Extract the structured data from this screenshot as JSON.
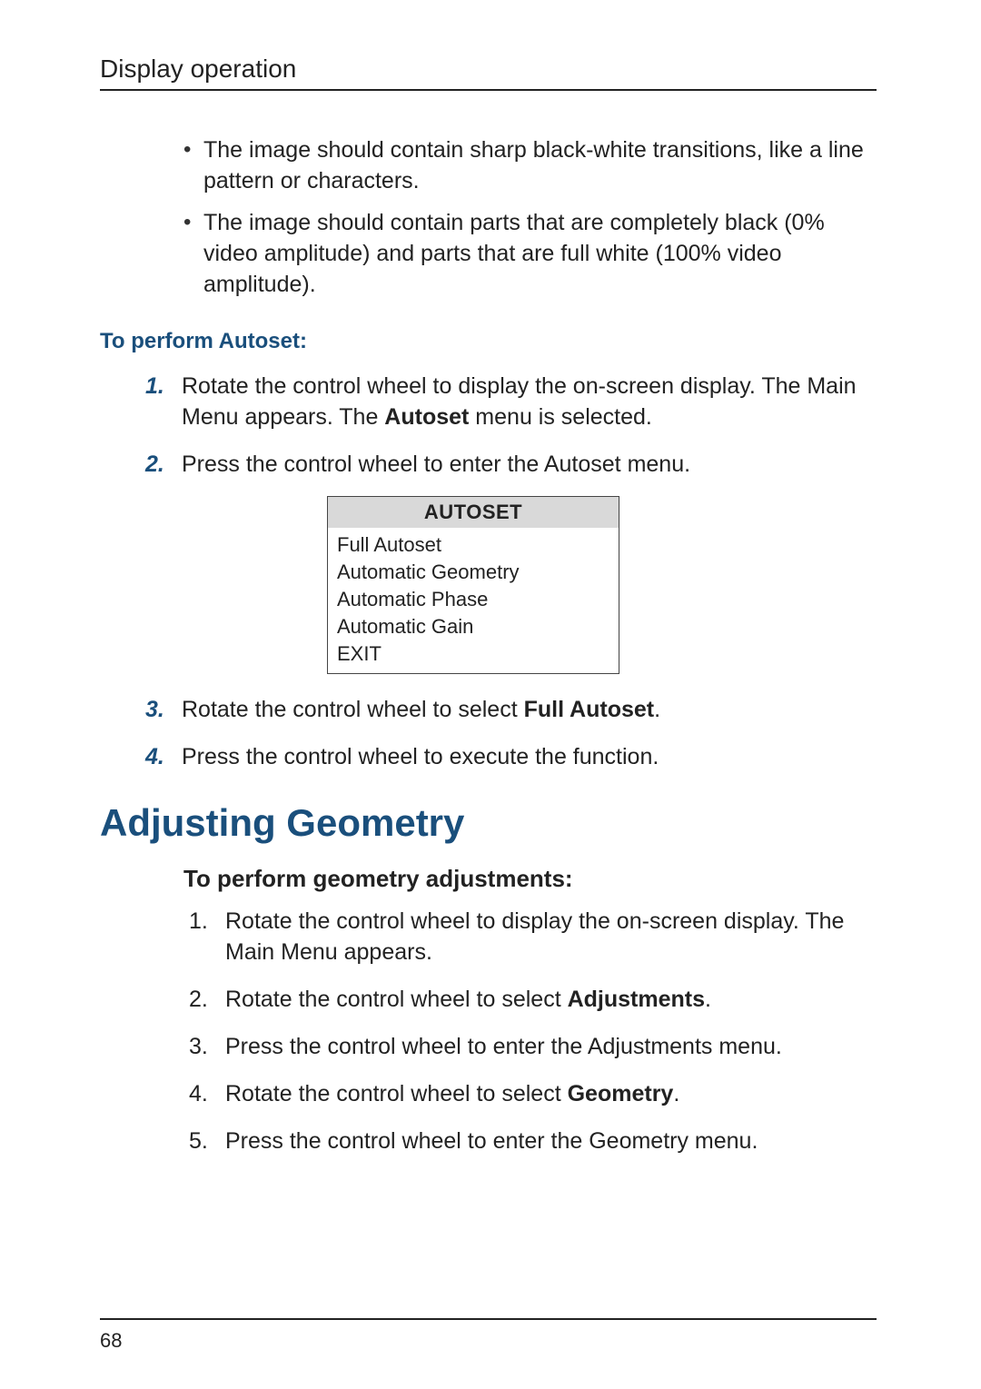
{
  "header": {
    "section": "Display operation"
  },
  "intro_bullets": [
    "The image should contain sharp black-white transitions, like a line pattern or characters.",
    "The image should contain parts that are completely black (0% video amplitude) and parts that are full white (100% video amplitude)."
  ],
  "autoset_heading": "To perform Autoset:",
  "autoset_steps": {
    "s1": {
      "num": "1.",
      "pre": "Rotate the control wheel to display the on-screen display. The Main Menu appears. The ",
      "bold": "Autoset",
      "post": " menu is selected."
    },
    "s2": {
      "num": "2.",
      "text": "Press the control wheel to enter the Autoset menu."
    },
    "s3": {
      "num": "3.",
      "pre": "Rotate the control wheel to select ",
      "bold": "Full Autoset",
      "post": "."
    },
    "s4": {
      "num": "4.",
      "text": "Press the control wheel to execute the function."
    }
  },
  "autoset_menu": {
    "title": "AUTOSET",
    "items": [
      "Full Autoset",
      "Automatic Geometry",
      "Automatic Phase",
      "Automatic Gain",
      "EXIT"
    ]
  },
  "h1": "Adjusting Geometry",
  "geometry_heading": "To perform geometry adjustments:",
  "geometry_steps": {
    "g1": {
      "num": "1.",
      "text": "Rotate the control wheel to display the on-screen display. The Main Menu appears."
    },
    "g2": {
      "num": "2.",
      "pre": "Rotate the control wheel to select ",
      "bold": "Adjustments",
      "post": "."
    },
    "g3": {
      "num": "3.",
      "text": "Press the control wheel to enter the Adjustments menu."
    },
    "g4": {
      "num": "4.",
      "pre": "Rotate the control wheel to select ",
      "bold": "Geometry",
      "post": "."
    },
    "g5": {
      "num": "5.",
      "text": "Press the control wheel to enter the Geometry menu."
    }
  },
  "footer": {
    "page_number": "68"
  }
}
